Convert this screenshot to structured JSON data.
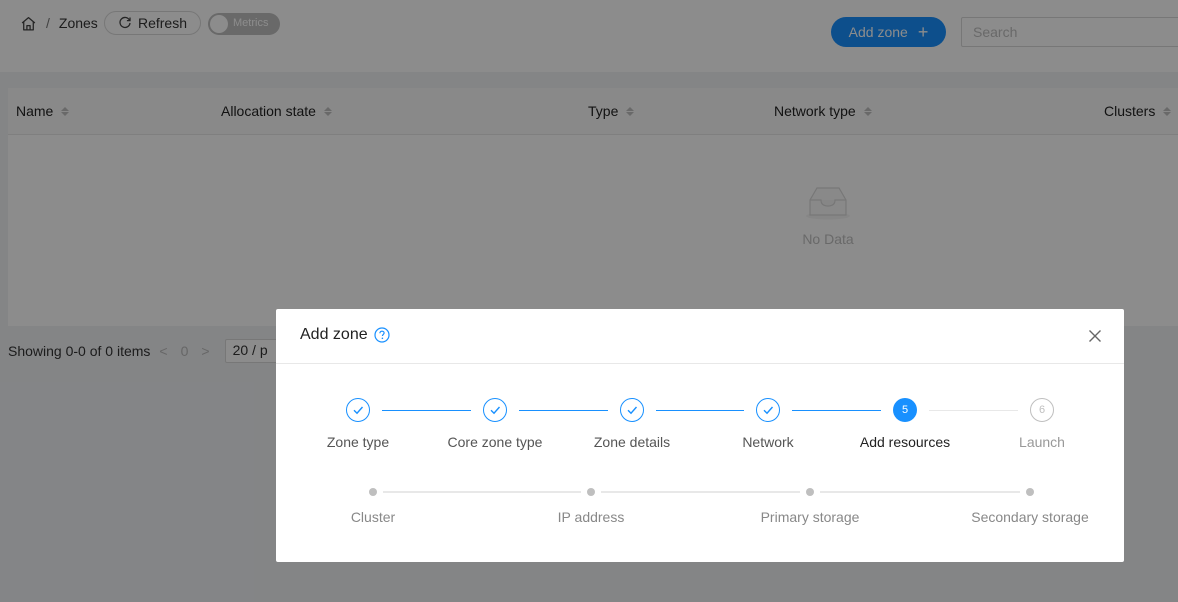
{
  "breadcrumb": {
    "sep": "/",
    "current": "Zones"
  },
  "toolbar": {
    "refresh_label": "Refresh",
    "metrics_label": "Metrics",
    "add_zone_label": "Add zone",
    "add_zone_plus": "+",
    "search_placeholder": "Search"
  },
  "table": {
    "columns": [
      "Name",
      "Allocation state",
      "Type",
      "Network type",
      "Clusters"
    ],
    "empty_text": "No Data"
  },
  "pagination": {
    "summary": "Showing 0-0 of 0 items",
    "prev": "<",
    "page": "0",
    "next": ">",
    "page_size": "20 / p"
  },
  "modal": {
    "title": "Add zone",
    "steps": [
      {
        "label": "Zone type",
        "status": "done"
      },
      {
        "label": "Core zone type",
        "status": "done"
      },
      {
        "label": "Zone details",
        "status": "done"
      },
      {
        "label": "Network",
        "status": "done"
      },
      {
        "label": "Add resources",
        "status": "current",
        "number": "5"
      },
      {
        "label": "Launch",
        "status": "pending",
        "number": "6"
      }
    ],
    "substeps": [
      "Cluster",
      "IP address",
      "Primary storage",
      "Secondary storage"
    ]
  },
  "colors": {
    "primary": "#1890ff",
    "pending": "#bfbfbf",
    "mask": "rgba(0,0,0,0.45)"
  }
}
